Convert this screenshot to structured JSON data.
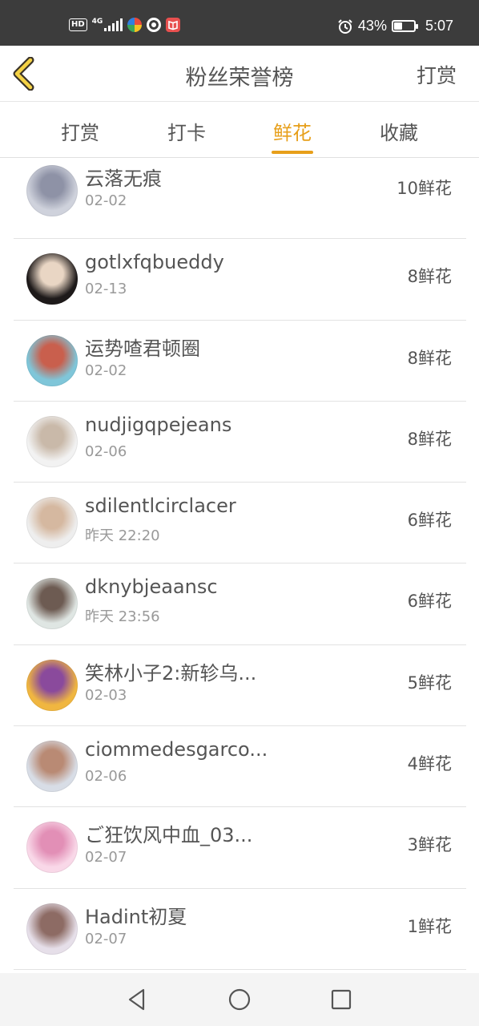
{
  "status_bar": {
    "network_badge": "HD",
    "network_type": "4G",
    "battery_percent": "43%",
    "battery_level": 0.43,
    "time": "5:07",
    "icons": [
      "hd-icon",
      "signal-icon",
      "app-icon-colorful",
      "app-icon-ball",
      "app-icon-book",
      "alarm-icon",
      "battery-icon"
    ]
  },
  "header": {
    "title": "粉丝荣誉榜",
    "right_action": "打赏",
    "back_icon": "chevron-left-icon",
    "accent_color": "#e79f1a"
  },
  "tabs": [
    {
      "label": "打赏",
      "active": false
    },
    {
      "label": "打卡",
      "active": false
    },
    {
      "label": "鲜花",
      "active": true
    },
    {
      "label": "收藏",
      "active": false
    }
  ],
  "fans": [
    {
      "name": "云落无痕",
      "date": "02-02",
      "count": "10鲜花",
      "avatar_colors": [
        "#cfd2dc",
        "#8e92a6"
      ]
    },
    {
      "name": "gotlxfqbueddy",
      "date": "02-13",
      "count": "8鲜花",
      "avatar_colors": [
        "#1e1a1a",
        "#e9d6c4"
      ]
    },
    {
      "name": "运势喳君顿圈",
      "date": "02-02",
      "count": "8鲜花",
      "avatar_colors": [
        "#7fc6d9",
        "#c95f4d"
      ]
    },
    {
      "name": "nudjigqpejeans",
      "date": "02-06",
      "count": "8鲜花",
      "avatar_colors": [
        "#f2f2f2",
        "#c9b9a9"
      ]
    },
    {
      "name": "sdilentlcirclacer",
      "date": "昨天 22:20",
      "count": "6鲜花",
      "avatar_colors": [
        "#eeeeee",
        "#d5b8a0"
      ]
    },
    {
      "name": "dknybjeaansc",
      "date": "昨天 23:56",
      "count": "6鲜花",
      "avatar_colors": [
        "#dfe6e3",
        "#6d5b52"
      ]
    },
    {
      "name": "笑林小子2:新轸乌...",
      "date": "02-03",
      "count": "5鲜花",
      "avatar_colors": [
        "#f0b640",
        "#8a4a9c"
      ]
    },
    {
      "name": "ciommedesgarco...",
      "date": "02-06",
      "count": "4鲜花",
      "avatar_colors": [
        "#d8dde6",
        "#b98a74"
      ]
    },
    {
      "name": "ご狂饮风中血_03...",
      "date": "02-07",
      "count": "3鲜花",
      "avatar_colors": [
        "#f9d8e8",
        "#e28fb6"
      ]
    },
    {
      "name": "Hadint初夏",
      "date": "02-07",
      "count": "1鲜花",
      "avatar_colors": [
        "#e6dfe9",
        "#8d6b64"
      ]
    }
  ],
  "nav_bar": {
    "icons": [
      "back-triangle-icon",
      "home-circle-icon",
      "recents-square-icon"
    ]
  }
}
